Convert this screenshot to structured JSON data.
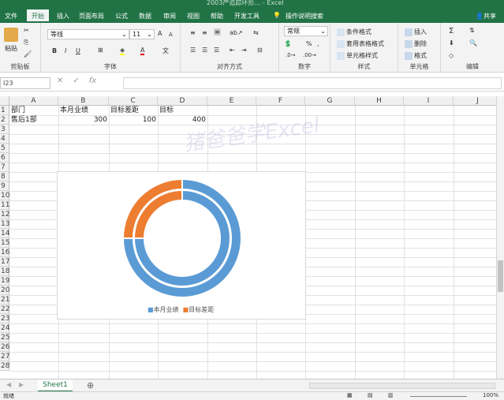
{
  "window": {
    "title": "2003产追踪环形… - Excel"
  },
  "menu": {
    "tabs": [
      "文件",
      "开始",
      "插入",
      "页面布局",
      "公式",
      "数据",
      "审阅",
      "视图",
      "帮助",
      "开发工具"
    ],
    "tell_me": "操作说明搜索",
    "share": "共享"
  },
  "ribbon": {
    "clipboard": {
      "paste": "粘贴",
      "label": "剪贴板"
    },
    "font": {
      "name": "等线",
      "size": "11",
      "bold": "B",
      "italic": "I",
      "underline": "U",
      "grow": "A",
      "shrink": "A",
      "label": "字体"
    },
    "alignment": {
      "label": "对齐方式"
    },
    "number": {
      "format": "常规",
      "percent": "%",
      "comma": ",",
      "label": "数字"
    },
    "styles": {
      "conditional": "条件格式",
      "table": "套用表格格式",
      "cell": "单元格样式",
      "label": "样式"
    },
    "cells": {
      "insert": "插入",
      "delete": "删除",
      "format": "格式",
      "label": "单元格"
    },
    "editing": {
      "sigma": "Σ",
      "label": "编辑"
    }
  },
  "formula": {
    "namebox": "I23",
    "fx": "fx"
  },
  "columns": [
    "A",
    "B",
    "C",
    "D",
    "E",
    "F",
    "G",
    "H",
    "I",
    "J"
  ],
  "rows": [
    "1",
    "2",
    "3",
    "4",
    "5",
    "6",
    "7",
    "8",
    "9",
    "10",
    "11",
    "12",
    "13",
    "14",
    "15",
    "16",
    "17",
    "18",
    "19",
    "20",
    "21",
    "22",
    "23",
    "24",
    "25",
    "26",
    "27",
    "28"
  ],
  "cells": {
    "a1": "部门",
    "b1": "本月业绩",
    "c1": "目标差距",
    "d1": "目标",
    "a2": "售后1部",
    "b2": "300",
    "c2": "100",
    "d2": "400"
  },
  "chart_data": {
    "type": "pie",
    "series": [
      {
        "name": "本月业绩",
        "values": [
          300
        ]
      },
      {
        "name": "目标差距",
        "values": [
          100
        ]
      }
    ],
    "categories": [
      "售后1部"
    ],
    "legend": "bottom",
    "colors": [
      "#5b9bd5",
      "#ed7d31"
    ]
  },
  "legend": {
    "s1": "本月业绩",
    "s2": "目标差距"
  },
  "watermark": "猪爸爸学Excel",
  "sheets": {
    "active": "Sheet1",
    "add": "⊕"
  },
  "status": {
    "ready": "就绪",
    "zoom": "100%"
  }
}
